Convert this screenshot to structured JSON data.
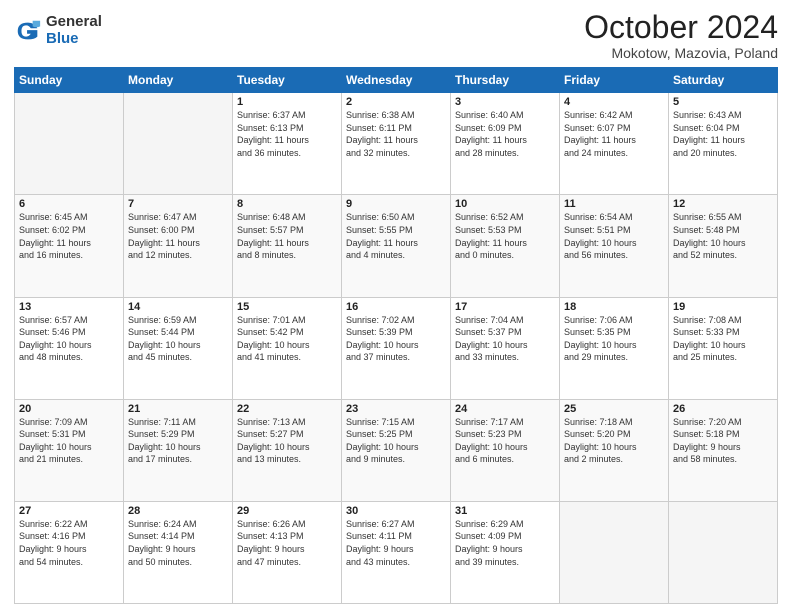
{
  "logo": {
    "general": "General",
    "blue": "Blue"
  },
  "title": "October 2024",
  "location": "Mokotow, Mazovia, Poland",
  "weekdays": [
    "Sunday",
    "Monday",
    "Tuesday",
    "Wednesday",
    "Thursday",
    "Friday",
    "Saturday"
  ],
  "weeks": [
    [
      {
        "day": "",
        "info": ""
      },
      {
        "day": "",
        "info": ""
      },
      {
        "day": "1",
        "info": "Sunrise: 6:37 AM\nSunset: 6:13 PM\nDaylight: 11 hours\nand 36 minutes."
      },
      {
        "day": "2",
        "info": "Sunrise: 6:38 AM\nSunset: 6:11 PM\nDaylight: 11 hours\nand 32 minutes."
      },
      {
        "day": "3",
        "info": "Sunrise: 6:40 AM\nSunset: 6:09 PM\nDaylight: 11 hours\nand 28 minutes."
      },
      {
        "day": "4",
        "info": "Sunrise: 6:42 AM\nSunset: 6:07 PM\nDaylight: 11 hours\nand 24 minutes."
      },
      {
        "day": "5",
        "info": "Sunrise: 6:43 AM\nSunset: 6:04 PM\nDaylight: 11 hours\nand 20 minutes."
      }
    ],
    [
      {
        "day": "6",
        "info": "Sunrise: 6:45 AM\nSunset: 6:02 PM\nDaylight: 11 hours\nand 16 minutes."
      },
      {
        "day": "7",
        "info": "Sunrise: 6:47 AM\nSunset: 6:00 PM\nDaylight: 11 hours\nand 12 minutes."
      },
      {
        "day": "8",
        "info": "Sunrise: 6:48 AM\nSunset: 5:57 PM\nDaylight: 11 hours\nand 8 minutes."
      },
      {
        "day": "9",
        "info": "Sunrise: 6:50 AM\nSunset: 5:55 PM\nDaylight: 11 hours\nand 4 minutes."
      },
      {
        "day": "10",
        "info": "Sunrise: 6:52 AM\nSunset: 5:53 PM\nDaylight: 11 hours\nand 0 minutes."
      },
      {
        "day": "11",
        "info": "Sunrise: 6:54 AM\nSunset: 5:51 PM\nDaylight: 10 hours\nand 56 minutes."
      },
      {
        "day": "12",
        "info": "Sunrise: 6:55 AM\nSunset: 5:48 PM\nDaylight: 10 hours\nand 52 minutes."
      }
    ],
    [
      {
        "day": "13",
        "info": "Sunrise: 6:57 AM\nSunset: 5:46 PM\nDaylight: 10 hours\nand 48 minutes."
      },
      {
        "day": "14",
        "info": "Sunrise: 6:59 AM\nSunset: 5:44 PM\nDaylight: 10 hours\nand 45 minutes."
      },
      {
        "day": "15",
        "info": "Sunrise: 7:01 AM\nSunset: 5:42 PM\nDaylight: 10 hours\nand 41 minutes."
      },
      {
        "day": "16",
        "info": "Sunrise: 7:02 AM\nSunset: 5:39 PM\nDaylight: 10 hours\nand 37 minutes."
      },
      {
        "day": "17",
        "info": "Sunrise: 7:04 AM\nSunset: 5:37 PM\nDaylight: 10 hours\nand 33 minutes."
      },
      {
        "day": "18",
        "info": "Sunrise: 7:06 AM\nSunset: 5:35 PM\nDaylight: 10 hours\nand 29 minutes."
      },
      {
        "day": "19",
        "info": "Sunrise: 7:08 AM\nSunset: 5:33 PM\nDaylight: 10 hours\nand 25 minutes."
      }
    ],
    [
      {
        "day": "20",
        "info": "Sunrise: 7:09 AM\nSunset: 5:31 PM\nDaylight: 10 hours\nand 21 minutes."
      },
      {
        "day": "21",
        "info": "Sunrise: 7:11 AM\nSunset: 5:29 PM\nDaylight: 10 hours\nand 17 minutes."
      },
      {
        "day": "22",
        "info": "Sunrise: 7:13 AM\nSunset: 5:27 PM\nDaylight: 10 hours\nand 13 minutes."
      },
      {
        "day": "23",
        "info": "Sunrise: 7:15 AM\nSunset: 5:25 PM\nDaylight: 10 hours\nand 9 minutes."
      },
      {
        "day": "24",
        "info": "Sunrise: 7:17 AM\nSunset: 5:23 PM\nDaylight: 10 hours\nand 6 minutes."
      },
      {
        "day": "25",
        "info": "Sunrise: 7:18 AM\nSunset: 5:20 PM\nDaylight: 10 hours\nand 2 minutes."
      },
      {
        "day": "26",
        "info": "Sunrise: 7:20 AM\nSunset: 5:18 PM\nDaylight: 9 hours\nand 58 minutes."
      }
    ],
    [
      {
        "day": "27",
        "info": "Sunrise: 6:22 AM\nSunset: 4:16 PM\nDaylight: 9 hours\nand 54 minutes."
      },
      {
        "day": "28",
        "info": "Sunrise: 6:24 AM\nSunset: 4:14 PM\nDaylight: 9 hours\nand 50 minutes."
      },
      {
        "day": "29",
        "info": "Sunrise: 6:26 AM\nSunset: 4:13 PM\nDaylight: 9 hours\nand 47 minutes."
      },
      {
        "day": "30",
        "info": "Sunrise: 6:27 AM\nSunset: 4:11 PM\nDaylight: 9 hours\nand 43 minutes."
      },
      {
        "day": "31",
        "info": "Sunrise: 6:29 AM\nSunset: 4:09 PM\nDaylight: 9 hours\nand 39 minutes."
      },
      {
        "day": "",
        "info": ""
      },
      {
        "day": "",
        "info": ""
      }
    ]
  ]
}
